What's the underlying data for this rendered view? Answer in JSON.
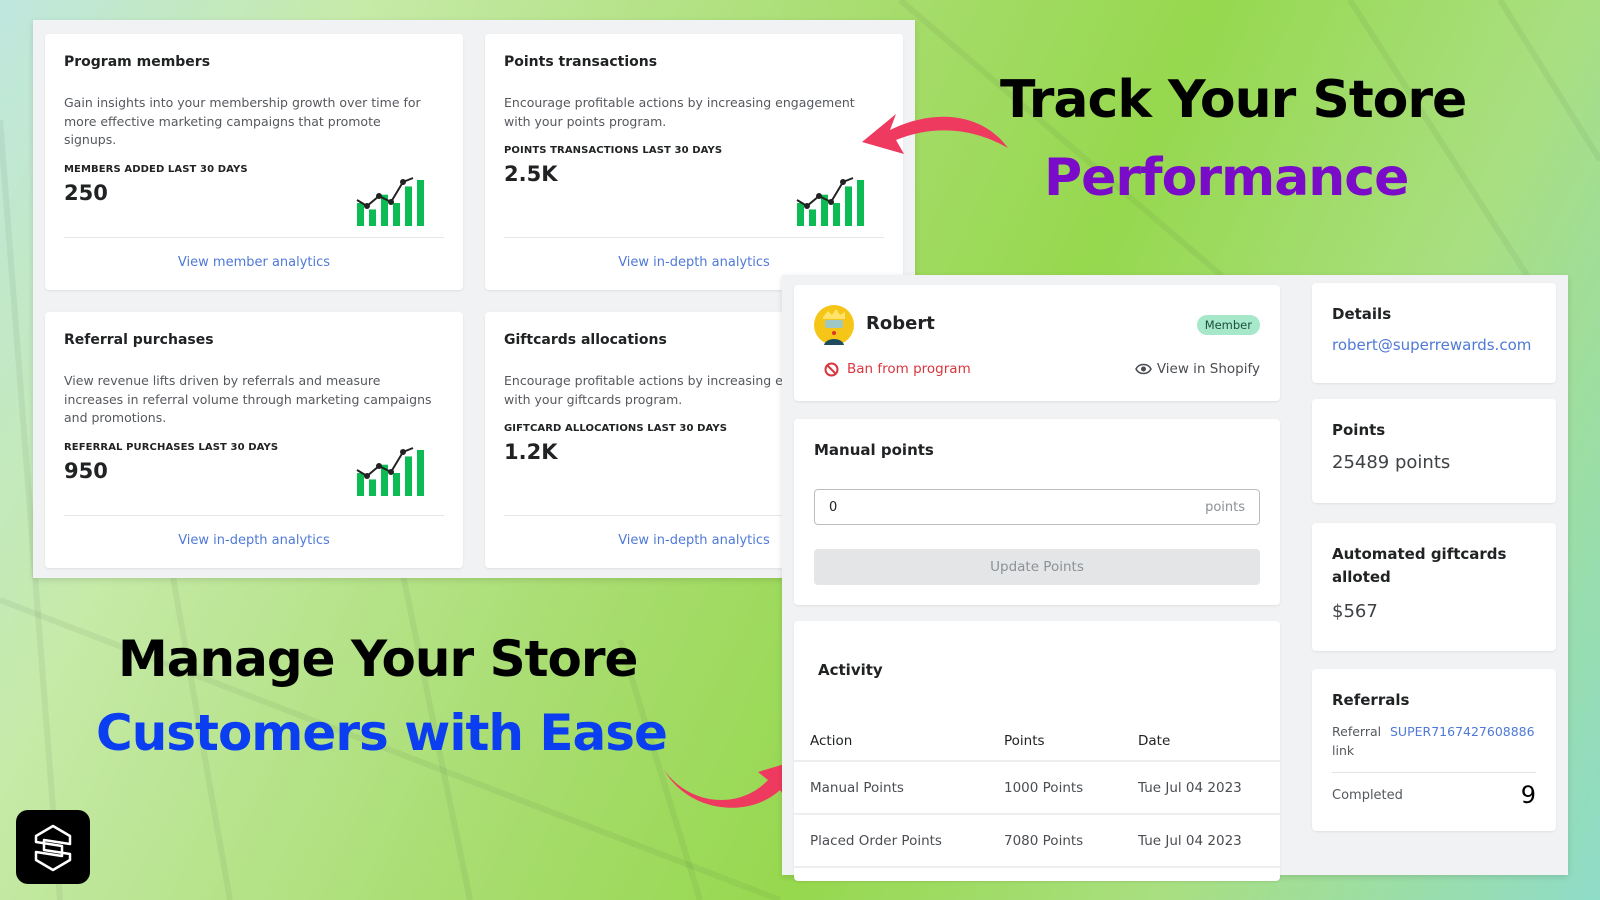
{
  "headlines": {
    "track_line1": "Track Your Store",
    "track_line2": "Performance",
    "manage_line1": "Manage Your  Store",
    "manage_line2": "Customers with Ease",
    "colors": {
      "black": "#000000",
      "purple": "#7a0bc8",
      "blue": "#0a3ef0",
      "arrow": "#ee3a5f"
    }
  },
  "logo": {
    "icon": "hexagon-s-logo-icon"
  },
  "analytics": {
    "cards": [
      {
        "title": "Program members",
        "description": "Gain insights into your membership growth over time for more effective marketing campaigns that promote signups.",
        "metric_label": "MEMBERS ADDED LAST 30 DAYS",
        "metric_value": "250",
        "link": "View member analytics",
        "chart_icon": "growth-bar-chart-icon"
      },
      {
        "title": "Points transactions",
        "description": "Encourage profitable actions by increasing engagement with your points program.",
        "metric_label": "POINTS TRANSACTIONS LAST 30 DAYS",
        "metric_value": "2.5K",
        "link": "View in-depth analytics",
        "chart_icon": "growth-bar-chart-icon"
      },
      {
        "title": "Referral purchases",
        "description": "View revenue lifts driven by referrals and measure increases in referral volume through marketing campaigns and promotions.",
        "metric_label": "REFERRAL PURCHASES LAST 30 DAYS",
        "metric_value": "950",
        "link": "View in-depth analytics",
        "chart_icon": "growth-bar-chart-icon"
      },
      {
        "title": "Giftcards allocations",
        "description": "Encourage profitable actions by increasing engagement with your giftcards program.",
        "metric_label": "GIFTCARD ALLOCATIONS LAST 30 DAYS",
        "metric_value": "1.2K",
        "link": "View in-depth analytics",
        "chart_icon": "growth-bar-chart-icon"
      }
    ]
  },
  "customer": {
    "name": "Robert",
    "badge": "Member",
    "ban_label": "Ban from program",
    "shopify_label": "View in Shopify",
    "manual_points": {
      "title": "Manual points",
      "input_value": "0",
      "input_suffix": "points",
      "button": "Update Points"
    },
    "activity": {
      "title": "Activity",
      "columns": [
        "Action",
        "Points",
        "Date"
      ],
      "rows": [
        [
          "Manual Points",
          "1000 Points",
          "Tue Jul 04 2023"
        ],
        [
          "Placed Order Points",
          "7080 Points",
          "Tue Jul 04 2023"
        ]
      ]
    },
    "details": {
      "title": "Details",
      "email": "robert@superrewards.com"
    },
    "points": {
      "title": "Points",
      "value": "25489 points"
    },
    "giftcards": {
      "title": "Automated giftcards alloted",
      "value": "$567"
    },
    "referrals": {
      "title": "Referrals",
      "link_label": "Referral link",
      "link_code": "SUPER7167427608886",
      "completed_label": "Completed",
      "completed_value": "9"
    }
  }
}
